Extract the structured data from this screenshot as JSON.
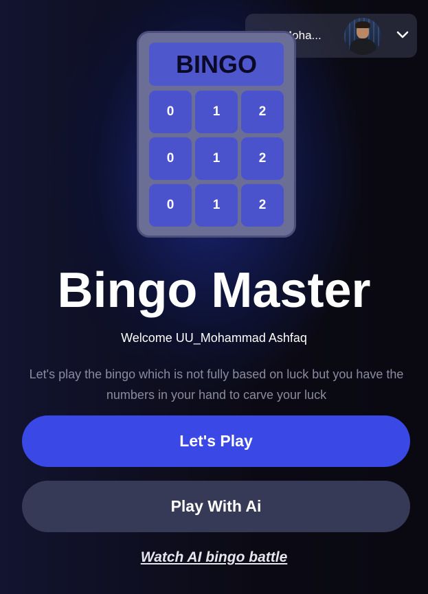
{
  "user_menu": {
    "name": "UU_Moha...",
    "avatar_icon": "user-avatar-photo",
    "dropdown_icon": "chevron-down-icon"
  },
  "bingo_card": {
    "header": "BINGO",
    "rows": [
      [
        "0",
        "1",
        "2"
      ],
      [
        "0",
        "1",
        "2"
      ],
      [
        "0",
        "1",
        "2"
      ]
    ]
  },
  "hero": {
    "title": "Bingo Master",
    "welcome": "Welcome UU_Mohammad Ashfaq",
    "tagline": "Let's play the bingo which is not fully based on luck but you have the numbers in your hand to carve your luck"
  },
  "actions": {
    "play_label": "Let's Play",
    "play_ai_label": "Play With Ai",
    "watch_label": "Watch AI bingo battle"
  },
  "colors": {
    "primary_button": "#3a48e6",
    "secondary_button": "#373a57",
    "card_cell": "#4a52cc",
    "background": "#0b0a14"
  }
}
